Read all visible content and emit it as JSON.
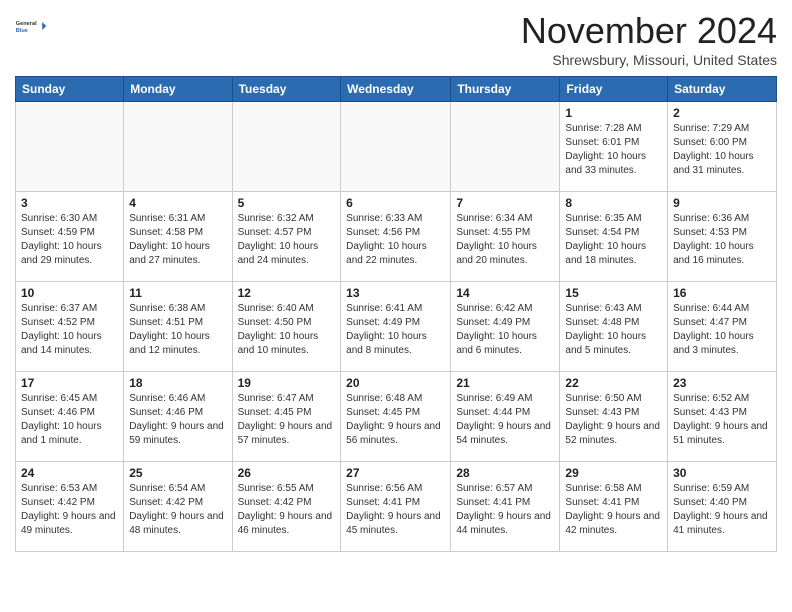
{
  "header": {
    "logo_general": "General",
    "logo_blue": "Blue",
    "month_title": "November 2024",
    "location": "Shrewsbury, Missouri, United States"
  },
  "days_of_week": [
    "Sunday",
    "Monday",
    "Tuesday",
    "Wednesday",
    "Thursday",
    "Friday",
    "Saturday"
  ],
  "weeks": [
    [
      {
        "day": "",
        "detail": ""
      },
      {
        "day": "",
        "detail": ""
      },
      {
        "day": "",
        "detail": ""
      },
      {
        "day": "",
        "detail": ""
      },
      {
        "day": "",
        "detail": ""
      },
      {
        "day": "1",
        "detail": "Sunrise: 7:28 AM\nSunset: 6:01 PM\nDaylight: 10 hours and 33 minutes."
      },
      {
        "day": "2",
        "detail": "Sunrise: 7:29 AM\nSunset: 6:00 PM\nDaylight: 10 hours and 31 minutes."
      }
    ],
    [
      {
        "day": "3",
        "detail": "Sunrise: 6:30 AM\nSunset: 4:59 PM\nDaylight: 10 hours and 29 minutes."
      },
      {
        "day": "4",
        "detail": "Sunrise: 6:31 AM\nSunset: 4:58 PM\nDaylight: 10 hours and 27 minutes."
      },
      {
        "day": "5",
        "detail": "Sunrise: 6:32 AM\nSunset: 4:57 PM\nDaylight: 10 hours and 24 minutes."
      },
      {
        "day": "6",
        "detail": "Sunrise: 6:33 AM\nSunset: 4:56 PM\nDaylight: 10 hours and 22 minutes."
      },
      {
        "day": "7",
        "detail": "Sunrise: 6:34 AM\nSunset: 4:55 PM\nDaylight: 10 hours and 20 minutes."
      },
      {
        "day": "8",
        "detail": "Sunrise: 6:35 AM\nSunset: 4:54 PM\nDaylight: 10 hours and 18 minutes."
      },
      {
        "day": "9",
        "detail": "Sunrise: 6:36 AM\nSunset: 4:53 PM\nDaylight: 10 hours and 16 minutes."
      }
    ],
    [
      {
        "day": "10",
        "detail": "Sunrise: 6:37 AM\nSunset: 4:52 PM\nDaylight: 10 hours and 14 minutes."
      },
      {
        "day": "11",
        "detail": "Sunrise: 6:38 AM\nSunset: 4:51 PM\nDaylight: 10 hours and 12 minutes."
      },
      {
        "day": "12",
        "detail": "Sunrise: 6:40 AM\nSunset: 4:50 PM\nDaylight: 10 hours and 10 minutes."
      },
      {
        "day": "13",
        "detail": "Sunrise: 6:41 AM\nSunset: 4:49 PM\nDaylight: 10 hours and 8 minutes."
      },
      {
        "day": "14",
        "detail": "Sunrise: 6:42 AM\nSunset: 4:49 PM\nDaylight: 10 hours and 6 minutes."
      },
      {
        "day": "15",
        "detail": "Sunrise: 6:43 AM\nSunset: 4:48 PM\nDaylight: 10 hours and 5 minutes."
      },
      {
        "day": "16",
        "detail": "Sunrise: 6:44 AM\nSunset: 4:47 PM\nDaylight: 10 hours and 3 minutes."
      }
    ],
    [
      {
        "day": "17",
        "detail": "Sunrise: 6:45 AM\nSunset: 4:46 PM\nDaylight: 10 hours and 1 minute."
      },
      {
        "day": "18",
        "detail": "Sunrise: 6:46 AM\nSunset: 4:46 PM\nDaylight: 9 hours and 59 minutes."
      },
      {
        "day": "19",
        "detail": "Sunrise: 6:47 AM\nSunset: 4:45 PM\nDaylight: 9 hours and 57 minutes."
      },
      {
        "day": "20",
        "detail": "Sunrise: 6:48 AM\nSunset: 4:45 PM\nDaylight: 9 hours and 56 minutes."
      },
      {
        "day": "21",
        "detail": "Sunrise: 6:49 AM\nSunset: 4:44 PM\nDaylight: 9 hours and 54 minutes."
      },
      {
        "day": "22",
        "detail": "Sunrise: 6:50 AM\nSunset: 4:43 PM\nDaylight: 9 hours and 52 minutes."
      },
      {
        "day": "23",
        "detail": "Sunrise: 6:52 AM\nSunset: 4:43 PM\nDaylight: 9 hours and 51 minutes."
      }
    ],
    [
      {
        "day": "24",
        "detail": "Sunrise: 6:53 AM\nSunset: 4:42 PM\nDaylight: 9 hours and 49 minutes."
      },
      {
        "day": "25",
        "detail": "Sunrise: 6:54 AM\nSunset: 4:42 PM\nDaylight: 9 hours and 48 minutes."
      },
      {
        "day": "26",
        "detail": "Sunrise: 6:55 AM\nSunset: 4:42 PM\nDaylight: 9 hours and 46 minutes."
      },
      {
        "day": "27",
        "detail": "Sunrise: 6:56 AM\nSunset: 4:41 PM\nDaylight: 9 hours and 45 minutes."
      },
      {
        "day": "28",
        "detail": "Sunrise: 6:57 AM\nSunset: 4:41 PM\nDaylight: 9 hours and 44 minutes."
      },
      {
        "day": "29",
        "detail": "Sunrise: 6:58 AM\nSunset: 4:41 PM\nDaylight: 9 hours and 42 minutes."
      },
      {
        "day": "30",
        "detail": "Sunrise: 6:59 AM\nSunset: 4:40 PM\nDaylight: 9 hours and 41 minutes."
      }
    ]
  ]
}
